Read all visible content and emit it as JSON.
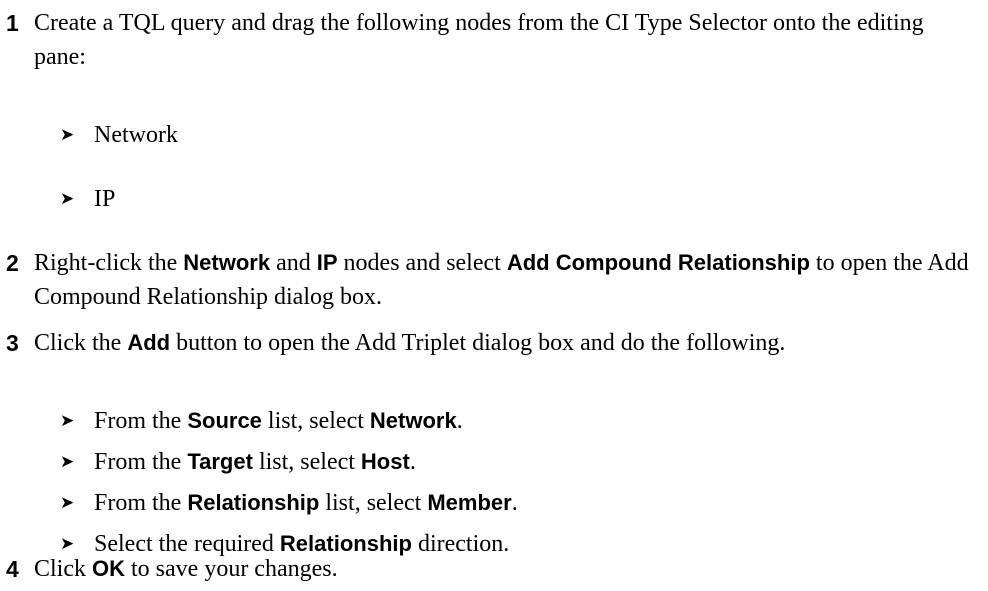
{
  "steps": [
    {
      "number": "1",
      "text": "Create a TQL query and drag the following nodes from the CI Type Selector onto the editing pane:",
      "bullets": [
        "Network",
        "IP"
      ]
    },
    {
      "number": "2",
      "parts": {
        "a": "Right-click the ",
        "b": "Network",
        "c": " and ",
        "d": "IP",
        "e": " nodes and select ",
        "f": "Add Compound Relationship",
        "g": " to open the Add Compound Relationship dialog box."
      }
    },
    {
      "number": "3",
      "parts": {
        "a": "Click the ",
        "b": "Add",
        "c": " button to open the Add Triplet dialog box and do the following."
      },
      "bullets": [
        {
          "a": "From the ",
          "b": "Source",
          "c": " list, select ",
          "d": "Network",
          "e": "."
        },
        {
          "a": "From the ",
          "b": "Target",
          "c": " list, select ",
          "d": "Host",
          "e": "."
        },
        {
          "a": "From the ",
          "b": "Relationship",
          "c": " list, select ",
          "d": "Member",
          "e": "."
        },
        {
          "a": "Select the required ",
          "b": "Relationship",
          "c": " direction."
        }
      ]
    },
    {
      "number": "4",
      "parts": {
        "a": "Click ",
        "b": "OK",
        "c": " to save your changes."
      }
    }
  ],
  "bullet_glyph": "➤"
}
